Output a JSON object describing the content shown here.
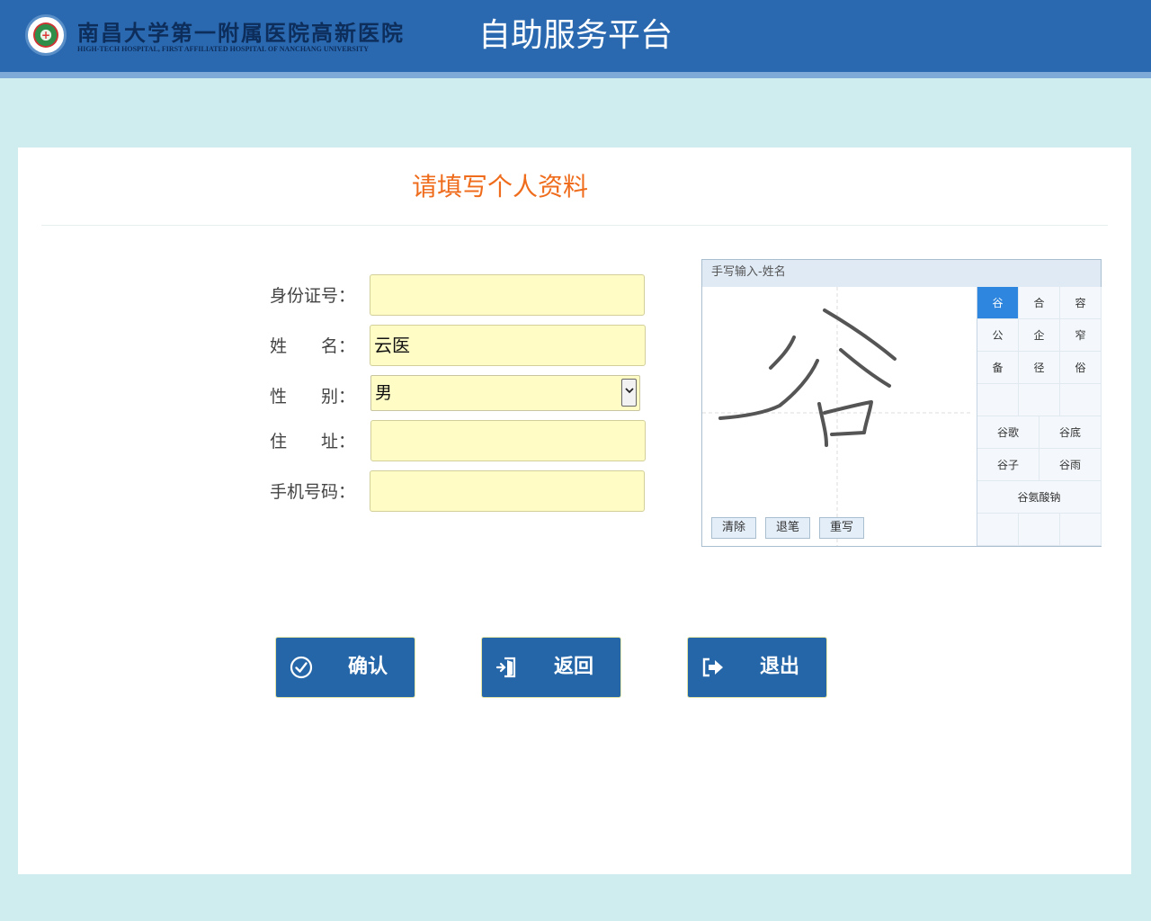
{
  "header": {
    "hospital_name_cn": "南昌大学第一附属医院高新医院",
    "hospital_name_en": "HIGH-TECH HOSPITAL, FIRST AFFILIATED HOSPITAL OF NANCHANG UNIVERSITY",
    "platform_title": "自助服务平台",
    "colors": {
      "bar": "#2a69b0",
      "accent_line": "#7fa9d6"
    }
  },
  "form": {
    "title": "请填写个人资料",
    "title_color": "#ef6c1c",
    "fields": [
      {
        "label": "身份证号：",
        "value": ""
      },
      {
        "label": "姓　　名：",
        "value": "云医"
      },
      {
        "label": "性　　别：",
        "value": "男"
      },
      {
        "label": "住　　址：",
        "value": ""
      },
      {
        "label": "手机号码：",
        "value": ""
      }
    ],
    "field_color": "#fffcc6"
  },
  "handwriting": {
    "title": "手写输入-姓名",
    "drawn_char": "谷",
    "buttons": [
      "清除",
      "退笔",
      "重写"
    ],
    "single_candidates": [
      "谷",
      "合",
      "容",
      "公",
      "企",
      "窄",
      "备",
      "径",
      "俗"
    ],
    "word_candidates": [
      "谷歌",
      "谷底",
      "谷子",
      "谷雨",
      "谷氨酸钠"
    ],
    "selected_candidate": "谷"
  },
  "actions": [
    {
      "label": "确认",
      "icon": "check-circle-icon"
    },
    {
      "label": "返回",
      "icon": "door-return-icon"
    },
    {
      "label": "退出",
      "icon": "exit-arrow-icon"
    }
  ]
}
